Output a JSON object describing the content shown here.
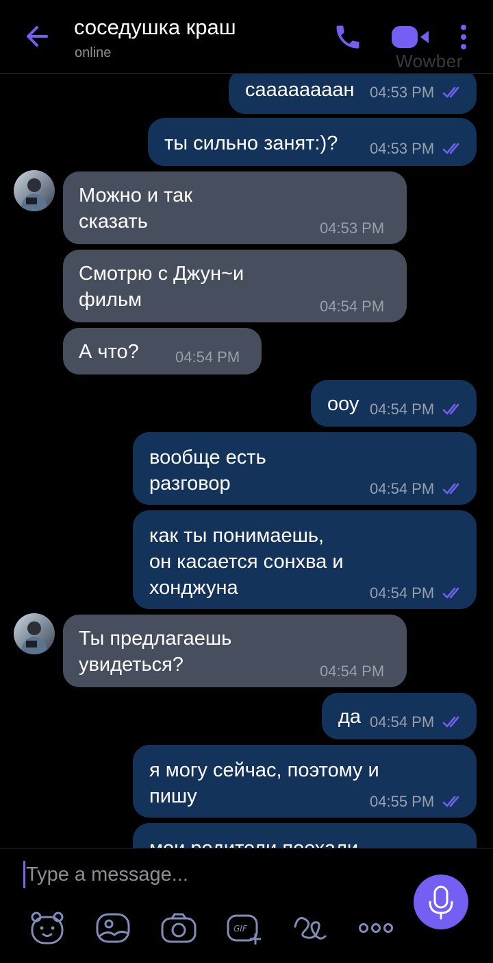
{
  "header": {
    "contact_name": "соседушка краш",
    "status": "online",
    "watermark": "Wowber",
    "icons": [
      "back-arrow-icon",
      "phone-icon",
      "video-camera-icon",
      "more-vertical-icon"
    ]
  },
  "colors": {
    "accent": "#7360f2",
    "outgoing_bubble": "#13335a",
    "incoming_bubble": "#474e5d",
    "background": "#000000"
  },
  "messages": [
    {
      "direction": "out",
      "text": "саааааааан",
      "time": "04:53 PM"
    },
    {
      "direction": "out",
      "text": "ты сильно занят:)?",
      "time": "04:53 PM"
    },
    {
      "direction": "in",
      "text": "Можно и так\nсказать",
      "time": "04:53 PM"
    },
    {
      "direction": "in",
      "text": "Смотрю с Джун~и\nфильм",
      "time": "04:54 PM"
    },
    {
      "direction": "in",
      "text": "А что?",
      "time": "04:54 PM"
    },
    {
      "direction": "out",
      "text": "ооу",
      "time": "04:54 PM"
    },
    {
      "direction": "out",
      "text": "вообще есть\nразговор",
      "time": "04:54 PM"
    },
    {
      "direction": "out",
      "text": "как ты понимаешь,\nон касается сонхва и\nхонджуна",
      "time": "04:54 PM"
    },
    {
      "direction": "in",
      "text": "Ты предлагаешь\nувидеться?",
      "time": "04:54 PM"
    },
    {
      "direction": "out",
      "text": "да",
      "time": "04:54 PM"
    },
    {
      "direction": "out",
      "text": "я могу сейчас, поэтому и\nпишу",
      "time": "04:55 PM"
    },
    {
      "direction": "out",
      "text": "мои родители поехали",
      "time": ""
    }
  ],
  "composer": {
    "placeholder": "Type a message...",
    "toolbar": [
      "sticker-bear-icon",
      "image-icon",
      "camera-icon",
      "gif-icon",
      "doodle-icon",
      "more-horizontal-icon",
      "microphone-icon"
    ]
  }
}
